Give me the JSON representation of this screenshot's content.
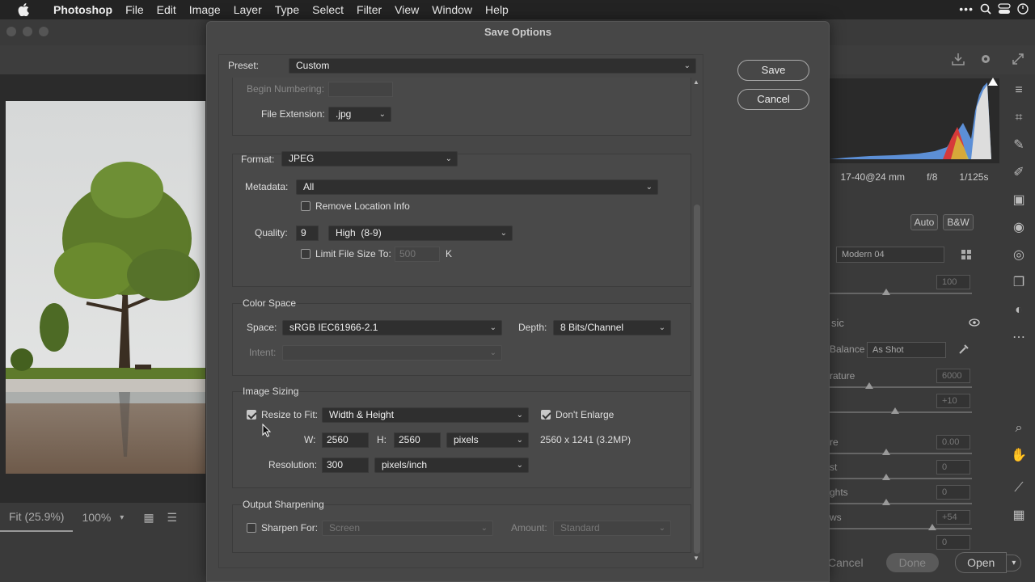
{
  "menubar": {
    "items": [
      "Photoshop",
      "File",
      "Edit",
      "Image",
      "Layer",
      "Type",
      "Select",
      "Filter",
      "View",
      "Window",
      "Help"
    ]
  },
  "background": {
    "zoom_fit": "Fit (25.9%)",
    "zoom_pct": "100%",
    "camera": {
      "lens": "17-40@24 mm",
      "aperture": "f/8",
      "shutter": "1/125s"
    },
    "auto_label": "Auto",
    "bw_label": "B&W",
    "profile": "Modern 04",
    "amount_value": "100",
    "section_fragment": "sic",
    "wb_fragment": "Balance",
    "wb_value": "As Shot",
    "temp_fragment": "rature",
    "temp_value": "6000",
    "tint_value": "+10",
    "exposure_fragment": "re",
    "exposure_value": "0.00",
    "contrast_fragment": "st",
    "contrast_value": "0",
    "highlights_fragment": "ghts",
    "highlights_value": "0",
    "shadows_fragment": "ws",
    "shadows_value": "+54",
    "whites_value": "0",
    "cancel_label": "Cancel",
    "done_label": "Done",
    "open_label": "Open"
  },
  "dialog": {
    "title": "Save Options",
    "preset_label": "Preset:",
    "preset_value": "Custom",
    "save_label": "Save",
    "cancel_label": "Cancel",
    "file_naming": {
      "begin_numbering_label": "Begin Numbering:",
      "file_extension_label": "File Extension:",
      "file_extension_value": ".jpg"
    },
    "format": {
      "format_label": "Format:",
      "format_value": "JPEG",
      "metadata_label": "Metadata:",
      "metadata_value": "All",
      "remove_location_label": "Remove Location Info",
      "remove_location_checked": false,
      "quality_label": "Quality:",
      "quality_value": "9",
      "quality_preset": "High  (8-9)",
      "limit_size_label": "Limit File Size To:",
      "limit_size_checked": false,
      "limit_size_value": "500",
      "limit_size_unit": "K"
    },
    "color_space": {
      "title": "Color Space",
      "space_label": "Space:",
      "space_value": "sRGB IEC61966-2.1",
      "depth_label": "Depth:",
      "depth_value": "8 Bits/Channel",
      "intent_label": "Intent:",
      "intent_value": ""
    },
    "image_sizing": {
      "title": "Image Sizing",
      "resize_label": "Resize to Fit:",
      "resize_checked": true,
      "resize_value": "Width & Height",
      "dont_enlarge_label": "Don't Enlarge",
      "dont_enlarge_checked": true,
      "w_label": "W:",
      "w_value": "2560",
      "h_label": "H:",
      "h_value": "2560",
      "unit_value": "pixels",
      "result_text": "2560 x 1241 (3.2MP)",
      "resolution_label": "Resolution:",
      "resolution_value": "300",
      "resolution_unit": "pixels/inch"
    },
    "output_sharpening": {
      "title": "Output Sharpening",
      "sharpen_label": "Sharpen For:",
      "sharpen_checked": false,
      "sharpen_value": "Screen",
      "amount_label": "Amount:",
      "amount_value": "Standard"
    }
  }
}
